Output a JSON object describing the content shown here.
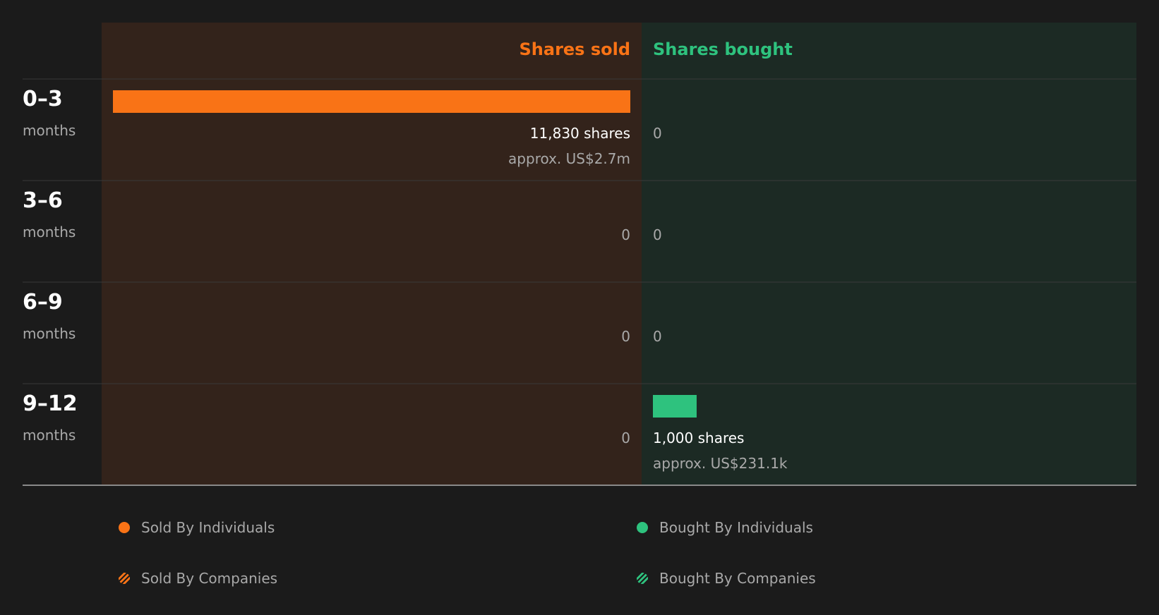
{
  "chart_data": {
    "type": "bar",
    "layout": "diverging-horizontal",
    "sold_header": "Shares sold",
    "bought_header": "Shares bought",
    "categories": [
      {
        "range": "0–3",
        "unit": "months"
      },
      {
        "range": "3–6",
        "unit": "months"
      },
      {
        "range": "6–9",
        "unit": "months"
      },
      {
        "range": "9–12",
        "unit": "months"
      }
    ],
    "series": [
      {
        "name": "Shares sold",
        "values": [
          11830,
          0,
          0,
          0
        ],
        "labels": [
          "11,830 shares",
          "0",
          "0",
          "0"
        ],
        "approx": [
          "approx. US$2.7m",
          "",
          "",
          ""
        ]
      },
      {
        "name": "Shares bought",
        "values": [
          0,
          0,
          0,
          1000
        ],
        "labels": [
          "0",
          "0",
          "0",
          "1,000 shares"
        ],
        "approx": [
          "",
          "",
          "",
          "approx. US$231.1k"
        ]
      }
    ],
    "xlim": [
      0,
      11830
    ],
    "grid": false,
    "legend_position": "bottom",
    "colors": {
      "sold": "#f97316",
      "bought": "#2ec27e",
      "sold_panel": "#33231b",
      "bought_panel": "#1c2a24",
      "background": "#1b1b1b"
    }
  },
  "legend": {
    "sold_individuals": "Sold By Individuals",
    "bought_individuals": "Bought By Individuals",
    "sold_companies": "Sold By Companies",
    "bought_companies": "Bought By Companies"
  }
}
